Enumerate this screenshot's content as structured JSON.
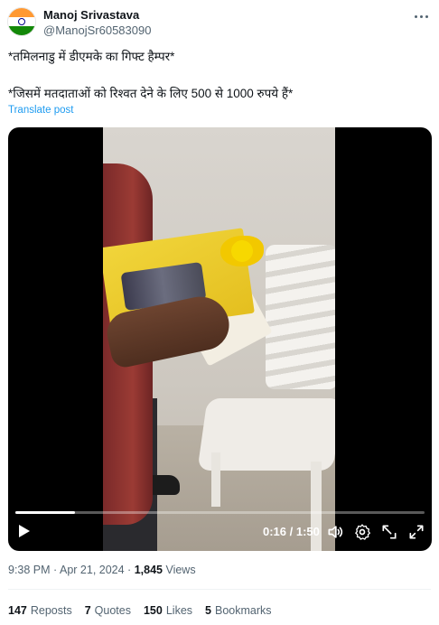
{
  "author": {
    "display_name": "Manoj Srivastava",
    "handle": "@ManojSr60583090",
    "avatar_icon": "india-flag-avatar"
  },
  "post": {
    "line1": "*तमिलनाडु में डीएमके का गिफ्ट हैम्पर*",
    "line2": "*जिसमें मतदाताओं को रिश्वत देने के लिए 500 से 1000 रुपये हैं*",
    "translate_label": "Translate post"
  },
  "video": {
    "current_time": "0:16",
    "duration": "1:50",
    "time_separator": " / ",
    "progress": 0.145
  },
  "meta": {
    "time": "9:38 PM",
    "separator": " · ",
    "date": "Apr 21, 2024",
    "views_count": "1,845",
    "views_label": "Views"
  },
  "stats": {
    "reposts_count": "147",
    "reposts_label": "Reposts",
    "quotes_count": "7",
    "quotes_label": "Quotes",
    "likes_count": "150",
    "likes_label": "Likes",
    "bookmarks_count": "5",
    "bookmarks_label": "Bookmarks"
  },
  "colors": {
    "link": "#1d9bf0",
    "secondary_text": "#536471",
    "primary_text": "#0f1419"
  }
}
